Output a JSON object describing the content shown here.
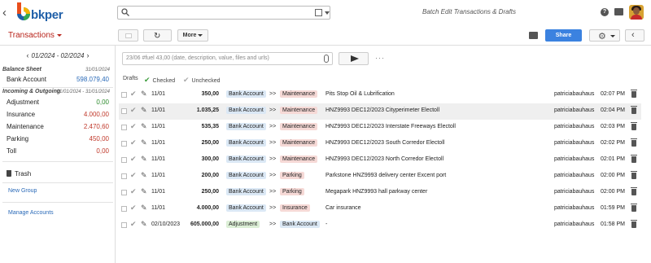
{
  "app": {
    "logo_text": "bkper",
    "page_title": "Batch Edit Transactions & Drafts"
  },
  "search": {
    "placeholder": ""
  },
  "book": {
    "title": "Transactions"
  },
  "toolbar": {
    "more_label": "More",
    "share_label": "Share"
  },
  "sidebar": {
    "period": "01/2024 - 02/2024",
    "groups": [
      {
        "title": "Balance Sheet",
        "date": "31/01/2024",
        "accounts": [
          {
            "name": "Bank Account",
            "value": "598.079,40",
            "color": "#2a6ab8"
          }
        ]
      },
      {
        "title": "Incoming & Outgoing",
        "date": "01/01/2024 - 31/01/2024",
        "accounts": [
          {
            "name": "Adjustment",
            "value": "0,00",
            "color": "#2e8b2e"
          },
          {
            "name": "Insurance",
            "value": "4.000,00",
            "color": "#c0392b"
          },
          {
            "name": "Maintenance",
            "value": "2.470,60",
            "color": "#c0392b"
          },
          {
            "name": "Parking",
            "value": "450,00",
            "color": "#c0392b"
          },
          {
            "name": "Toll",
            "value": "0,00",
            "color": "#c0392b"
          }
        ]
      }
    ],
    "trash_label": "Trash",
    "new_group_label": "New Group",
    "manage_accounts_label": "Manage Accounts"
  },
  "composer": {
    "placeholder": "23/06 #fuel 43,00 (date, description, value, files and urls)"
  },
  "filters": {
    "drafts": "Drafts",
    "checked": "Checked",
    "unchecked": "Unchecked"
  },
  "transactions": [
    {
      "date": "11/01",
      "amount": "350,00",
      "from": "Bank Account",
      "from_type": "bank",
      "to": "Maintenance",
      "to_type": "maint",
      "description": "Pits Stop Oil & Lubrification",
      "user": "patriciabauhaus",
      "time": "02:07 PM"
    },
    {
      "date": "11/01",
      "amount": "1.035,25",
      "from": "Bank Account",
      "from_type": "bank",
      "to": "Maintenance",
      "to_type": "maint",
      "description": "HNZ9993 DEC12/2023 Cityperimeter Electoll",
      "user": "patriciabauhaus",
      "time": "02:04 PM"
    },
    {
      "date": "11/01",
      "amount": "535,35",
      "from": "Bank Account",
      "from_type": "bank",
      "to": "Maintenance",
      "to_type": "maint",
      "description": "HNZ9993 DEC12/2023 Interstate Freeways Electoll",
      "user": "patriciabauhaus",
      "time": "02:03 PM"
    },
    {
      "date": "11/01",
      "amount": "250,00",
      "from": "Bank Account",
      "from_type": "bank",
      "to": "Maintenance",
      "to_type": "maint",
      "description": "HNZ9993 DEC12/2023 South Corredor Electoll",
      "user": "patriciabauhaus",
      "time": "02:02 PM"
    },
    {
      "date": "11/01",
      "amount": "300,00",
      "from": "Bank Account",
      "from_type": "bank",
      "to": "Maintenance",
      "to_type": "maint",
      "description": "HNZ9993 DEC12/2023 North Corredor Electoll",
      "user": "patriciabauhaus",
      "time": "02:01 PM"
    },
    {
      "date": "11/01",
      "amount": "200,00",
      "from": "Bank Account",
      "from_type": "bank",
      "to": "Parking",
      "to_type": "park",
      "description": "Parkstone HNZ9993 delivery center Excent port",
      "user": "patriciabauhaus",
      "time": "02:00 PM"
    },
    {
      "date": "11/01",
      "amount": "250,00",
      "from": "Bank Account",
      "from_type": "bank",
      "to": "Parking",
      "to_type": "park",
      "description": "Megapark HNZ9993 hall parkway center",
      "user": "patriciabauhaus",
      "time": "02:00 PM"
    },
    {
      "date": "11/01",
      "amount": "4.000,00",
      "from": "Bank Account",
      "from_type": "bank",
      "to": "Insurance",
      "to_type": "ins",
      "description": "Car insurance",
      "user": "patriciabauhaus",
      "time": "01:59 PM"
    },
    {
      "date": "02/10/2023",
      "amount": "605.000,00",
      "from": "Adjustment",
      "from_type": "adj",
      "to": "Bank Account",
      "to_type": "bank",
      "description": "-",
      "user": "patriciabauhaus",
      "time": "01:58 PM"
    }
  ],
  "highlighted_row": 1,
  "arrow_text": ">>"
}
